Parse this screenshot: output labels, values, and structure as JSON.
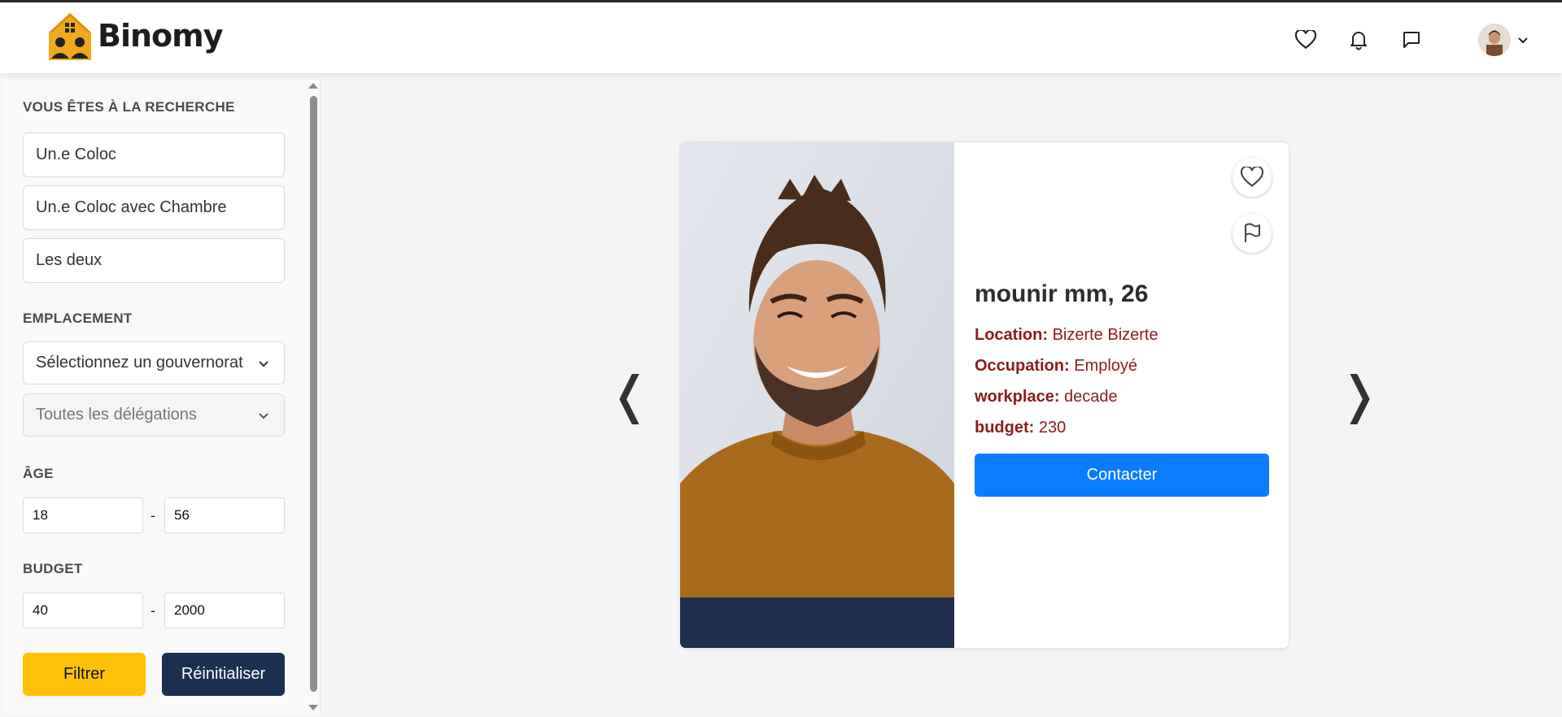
{
  "brand": {
    "name": "Binomy"
  },
  "nav": {
    "icons": [
      "heart-icon",
      "bell-icon",
      "chat-icon"
    ]
  },
  "filters": {
    "search_title": "VOUS ÊTES À LA RECHERCHE",
    "search_options": [
      "Un.e Coloc",
      "Un.e Coloc avec Chambre",
      "Les deux"
    ],
    "location_title": "EMPLACEMENT",
    "gouvernorat_select": "Sélectionnez un gouvernorat",
    "delegation_select": "Toutes les délégations",
    "age_title": "ÂGE",
    "age_min": "18",
    "age_max": "56",
    "budget_title": "BUDGET",
    "budget_min": "40",
    "budget_max": "2000",
    "separator": "-",
    "filter_button": "Filtrer",
    "reset_button": "Réinitialiser"
  },
  "carousel": {
    "prev": "❬",
    "next": "❭"
  },
  "profile": {
    "name_age": "mounir mm, 26",
    "location_label": "Location:",
    "location_value": "Bizerte Bizerte",
    "occupation_label": "Occupation:",
    "occupation_value": "Employé",
    "workplace_label": "workplace:",
    "workplace_value": "decade",
    "budget_label": "budget:",
    "budget_value": "230",
    "contact_button": "Contacter"
  },
  "colors": {
    "accent_blue": "#0a7cff",
    "filter_yellow": "#ffc107",
    "reset_navy": "#1b2f52",
    "label_red": "#8b1c1c"
  }
}
